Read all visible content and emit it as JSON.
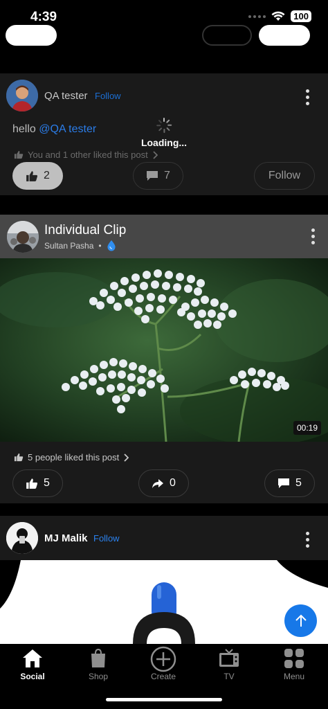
{
  "status_bar": {
    "time": "4:39",
    "battery": "100"
  },
  "posts": [
    {
      "author": "QA tester",
      "follow_label": "Follow",
      "text_prefix": "hello ",
      "mention": "@QA tester",
      "likes_summary": "You and 1 other liked this post",
      "like_count": "2",
      "comment_count": "7",
      "follow_button": "Follow"
    },
    {
      "title": "Individual Clip",
      "author": "Sultan Pasha",
      "separator": "•",
      "duration": "00:19",
      "likes_summary": "5 people liked this post",
      "like_count": "5",
      "share_count": "0",
      "comment_count": "5"
    },
    {
      "author": "MJ Malik",
      "follow_label": "Follow"
    }
  ],
  "loading": {
    "text": "Loading..."
  },
  "tabs": [
    {
      "label": "Social",
      "icon": "home-icon",
      "active": true
    },
    {
      "label": "Shop",
      "icon": "shopping-bag-icon",
      "active": false
    },
    {
      "label": "Create",
      "icon": "plus-circle-icon",
      "active": false
    },
    {
      "label": "TV",
      "icon": "tv-icon",
      "active": false
    },
    {
      "label": "Menu",
      "icon": "grid-icon",
      "active": false
    }
  ],
  "colors": {
    "accent": "#1778E8",
    "link": "#2B7DE9",
    "card": "#1A1A1A",
    "header_gray": "#474747"
  }
}
